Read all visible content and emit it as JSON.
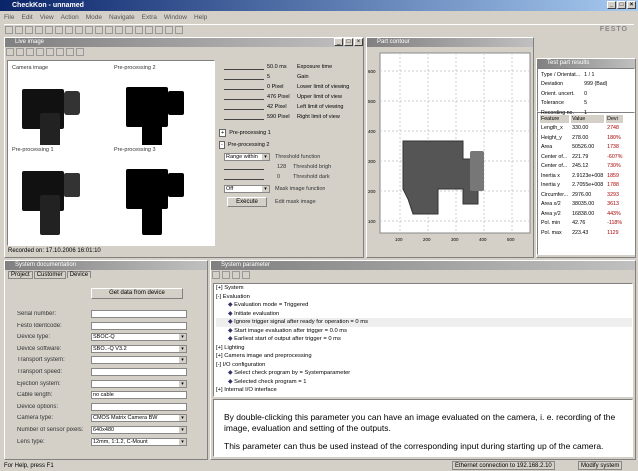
{
  "app": {
    "title": "CheckKon - unnamed",
    "brand": "FESTO"
  },
  "menu": [
    "File",
    "Edit",
    "View",
    "Action",
    "Mode",
    "Navigate",
    "Extra",
    "Window",
    "Help"
  ],
  "live": {
    "title": "Live image",
    "thumbs": [
      "Camera image",
      "Pre-processing 2",
      "Pre-processing 1",
      "Pre-processing 3"
    ],
    "recorded": "Recorded on: 17.10.2006  16:01:10"
  },
  "params": [
    {
      "value": "50.0 ms",
      "label": "Exposure time"
    },
    {
      "value": "5",
      "label": "Gain"
    },
    {
      "value": "0 Pixel",
      "label": "Lower limit of viewing"
    },
    {
      "value": "476 Pixel",
      "label": "Upper limit of view"
    },
    {
      "value": "42 Pixel",
      "label": "Left limit of viewing"
    },
    {
      "value": "590 Pixel",
      "label": "Right limit of view"
    }
  ],
  "preproc": {
    "p1": "Pre-processing 1",
    "p2": "Pre-processing 2",
    "mode": "Range within",
    "thr_fn": "Threshold function",
    "v1": "128",
    "l1": "Threshold brigh",
    "v2": "0",
    "l2": "Threshold dark",
    "off": "Off",
    "mask": "Mask image function",
    "execute": "Execute",
    "edit_mask": "Edit mask image"
  },
  "contour": {
    "title": "Part contour",
    "yticks": [
      "600",
      "500",
      "400",
      "300",
      "200",
      "100"
    ],
    "xticks": [
      "100",
      "200",
      "300",
      "400",
      "500"
    ]
  },
  "tp": {
    "title": "Test part results",
    "rows": [
      [
        "Type / Orientat...",
        "1 / 1"
      ],
      [
        "Deviation",
        "999 (Bad)"
      ],
      [
        "Orient. uncert.",
        "0"
      ],
      [
        "Tolerance",
        "5"
      ],
      [
        "Recording no.",
        "1"
      ]
    ],
    "headers": [
      "Feature",
      "Value",
      "Devi"
    ],
    "features": [
      [
        "Length_x",
        "330.00",
        "2748"
      ],
      [
        "Height_y",
        "278.00",
        "180%"
      ],
      [
        "Area",
        "50526.00",
        "1738"
      ],
      [
        "Center of...",
        "221.79",
        "-607%"
      ],
      [
        "Center of...",
        "245.12",
        "730%"
      ],
      [
        "Inertia x",
        "2.9123e+008",
        "1859"
      ],
      [
        "Inertia y",
        "2.7055e+008",
        "1788"
      ],
      [
        "Circumfer...",
        "2976.00",
        "3293"
      ],
      [
        "Area x/2",
        "38035.00",
        "3613"
      ],
      [
        "Area y/2",
        "16838.00",
        "443%"
      ],
      [
        "Pol. min",
        "42.76",
        "-118%"
      ],
      [
        "Pol. max",
        "223.43",
        "1129"
      ]
    ]
  },
  "sysdoc": {
    "title": "System documentation",
    "tabs": [
      "Project",
      "Customer",
      "Device"
    ],
    "get_btn": "Get data from device",
    "fields": [
      [
        "Serial number:",
        ""
      ],
      [
        "Festo Identcode:",
        ""
      ],
      [
        "Device type:",
        "SBOC-Q"
      ],
      [
        "Device software:",
        "SBO..-Q  V3.2"
      ],
      [
        "Transport system:",
        ""
      ],
      [
        "Transport speed:",
        ""
      ],
      [
        "Ejection system:",
        ""
      ],
      [
        "Cable length:",
        "no cable"
      ],
      [
        "Device options:",
        ""
      ],
      [
        "Camera type:",
        "CMOS Matrix Camera BW"
      ],
      [
        "Number of sensor pixels:",
        "640x480"
      ],
      [
        "Lens type:",
        "12mm, 1:1.2, C-Mount"
      ]
    ]
  },
  "sysparam": {
    "title": "System parameter",
    "tree": [
      {
        "t": "System",
        "i": 0,
        "k": "+"
      },
      {
        "t": "Evaluation",
        "i": 0,
        "k": "-"
      },
      {
        "t": "Evaluation mode = Triggered",
        "i": 2,
        "k": "•"
      },
      {
        "t": "Initiate evaluation",
        "i": 2,
        "k": "•"
      },
      {
        "t": "Ignore trigger signal after ready for operation = 0 ms",
        "i": 2,
        "k": "•"
      },
      {
        "t": "Start image evaluation after trigger = 0.0 ms",
        "i": 2,
        "k": "•"
      },
      {
        "t": "Earliest start of output after trigger = 0 ms",
        "i": 2,
        "k": "•"
      },
      {
        "t": "Lighting",
        "i": 0,
        "k": "+"
      },
      {
        "t": "Camera image and preprocessing",
        "i": 0,
        "k": "+"
      },
      {
        "t": "I/O configuration",
        "i": 0,
        "k": "-"
      },
      {
        "t": "Select check program by = Systemparameter",
        "i": 2,
        "k": "•"
      },
      {
        "t": "Selected check program = 1",
        "i": 2,
        "k": "•"
      },
      {
        "t": "Internal I/O interface",
        "i": 0,
        "k": "+"
      }
    ],
    "help1": "By double-clicking this parameter you can have an image evaluated on the camera, i. e. recording of the image, evaluation and setting of the outputs.",
    "help2": "This parameter can thus be used instead of the corresponding input during starting up of the camera."
  },
  "status": {
    "left": "For Help, press F1",
    "conn": "Ethernet connection to 192.168.2.10",
    "mode": "Modify system"
  }
}
